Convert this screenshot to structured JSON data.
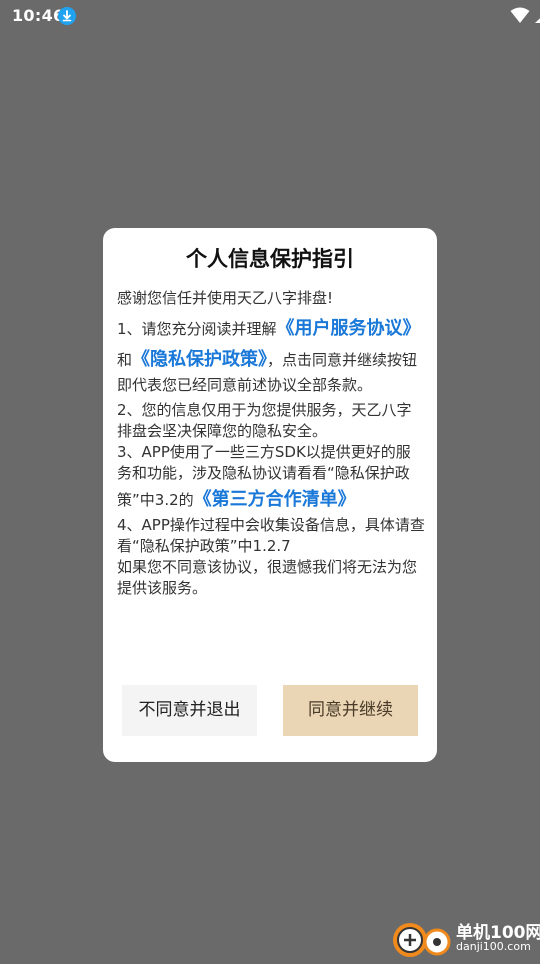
{
  "status_bar": {
    "time": "10:46"
  },
  "dialog": {
    "title": "个人信息保护指引",
    "intro": "感谢您信任并使用天乙八字排盘!",
    "p1_a": "1、请您充分阅读并理解",
    "p1_link_agreement": "《用户服务协议》",
    "p1_and": "和",
    "p1_link_privacy": "《隐私保护政策》",
    "p1_b": "，点击同意并继续按钮即代表您已经同意前述协议全部条款。",
    "p2": "2、您的信息仅用于为您提供服务，天乙八字排盘会坚决保障您的隐私安全。",
    "p3_a": "3、APP使用了一些三方SDK以提供更好的服务和功能，涉及隐私协议请看看“隐私保护政策”中3.2的",
    "p3_link": "《第三方合作清单》",
    "p4": "4、APP操作过程中会收集设备信息，具体请查看“隐私保护政策”中1.2.7",
    "p5": "如果您不同意该协议，很遗憾我们将无法为您提供该服务。",
    "decline_label": "不同意并退出",
    "accept_label": "同意并继续"
  },
  "watermark": {
    "site_name": "单机100网",
    "site_url": "danji100.com"
  },
  "colors": {
    "overlay": "#6a6a6a",
    "link": "#1a78d8",
    "accept_button": "#ead5b5",
    "decline_button": "#f4f4f4"
  }
}
